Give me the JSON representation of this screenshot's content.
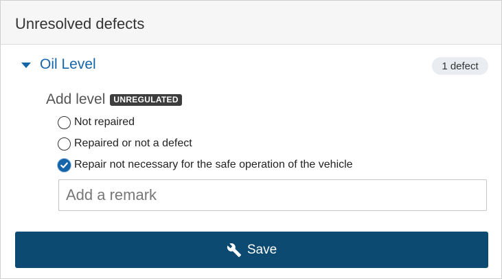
{
  "panel": {
    "title": "Unresolved defects"
  },
  "section": {
    "title": "Oil Level",
    "expanded": true,
    "badge": "1 defect"
  },
  "field": {
    "label": "Add level",
    "tag": "UNREGULATED",
    "options": [
      {
        "label": "Not repaired",
        "checked": false
      },
      {
        "label": "Repaired or not a defect",
        "checked": false
      },
      {
        "label": "Repair not necessary for the safe operation of the vehicle",
        "checked": true
      }
    ],
    "remark": {
      "value": "",
      "placeholder": "Add a remark"
    }
  },
  "actions": {
    "save_label": "Save",
    "save_icon": "wrench-icon"
  },
  "colors": {
    "accent": "#1565a8",
    "button": "#0c4a71",
    "badge_bg": "#e9ecf1",
    "tag_bg": "#3d3d3d"
  }
}
